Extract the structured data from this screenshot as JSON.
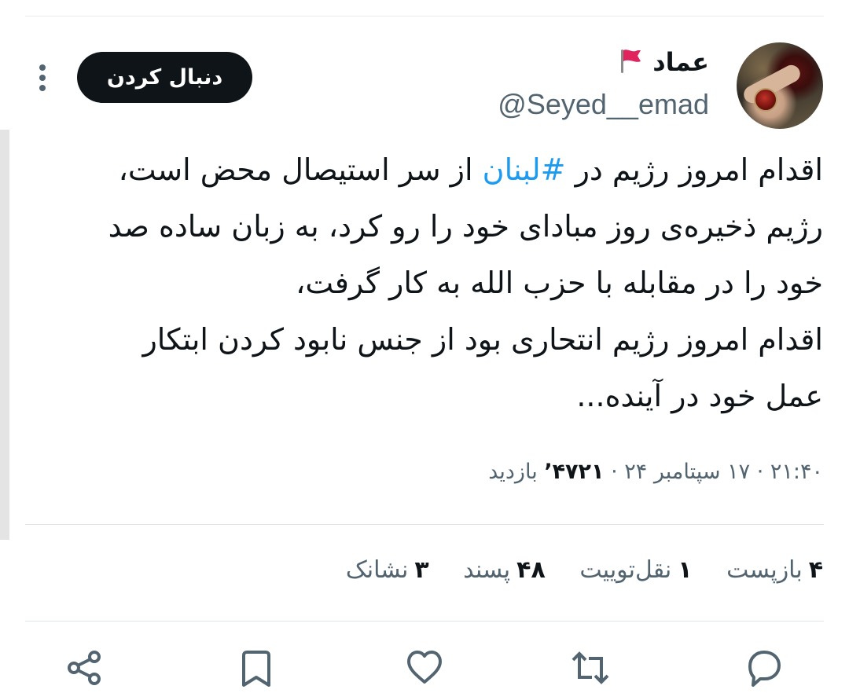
{
  "user": {
    "display_name": "عماد",
    "handle": "@Seyed__emad"
  },
  "follow_button": "دنبال کردن",
  "tweet": {
    "lines": [
      {
        "before": "اقدام امروز رژیم در ",
        "hashtag": "#لبنان",
        "after": " از سر استیصال محض است،"
      },
      {
        "text": "رژیم ذخیره‌ی روز مبادای خود را رو کرد، به زبان ساده صد"
      },
      {
        "text": "خود را در مقابله با حزب الله به کار گرفت،"
      },
      {
        "text": "اقدام امروز رژیم انتحاری بود از جنس نابود کردن ابتکار"
      },
      {
        "text": "عمل خود در آینده..."
      }
    ]
  },
  "meta": {
    "time": "۲۱:۴۰",
    "date": "۱۷ سپتامبر ۲۴",
    "views_count": "۴۷۲۱’",
    "views_label": "بازدید"
  },
  "stats": {
    "reposts_count": "۴",
    "reposts_label": "بازپست",
    "quotes_count": "۱",
    "quotes_label": "نقل‌توییت",
    "likes_count": "۴۸",
    "likes_label": "پسند",
    "bookmarks_count": "۳",
    "bookmarks_label": "نشانک"
  },
  "icons": {
    "flag": "red-flag-icon",
    "more": "more-options-icon",
    "reply": "reply-icon",
    "retweet": "retweet-icon",
    "like": "heart-icon",
    "bookmark": "bookmark-icon",
    "share": "share-icon"
  },
  "colors": {
    "hashtag": "#1d9bf0",
    "text": "#0f1419",
    "secondary": "#536471",
    "button_bg": "#0f1419",
    "flag": "#e0245e"
  }
}
